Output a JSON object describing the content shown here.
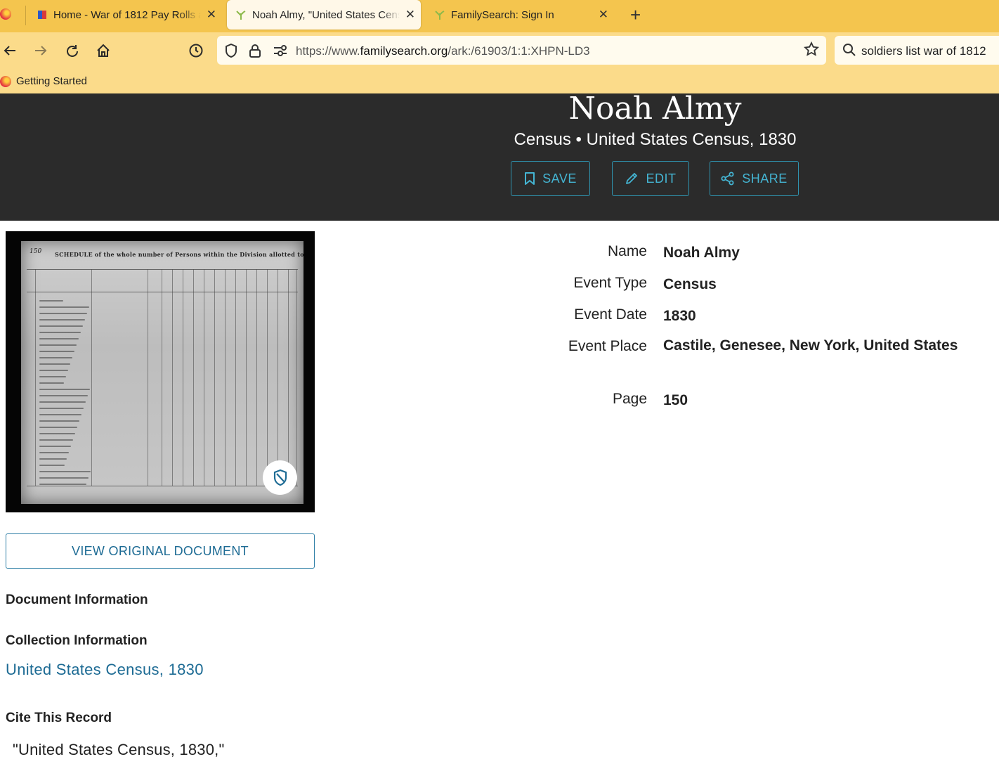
{
  "browser": {
    "tabs": [
      {
        "title": "Home - War of 1812 Pay Rolls and Muster Rolls"
      },
      {
        "title": "Noah Almy, \"United States Census, 1830\""
      },
      {
        "title": "FamilySearch: Sign In"
      }
    ],
    "url_prefix": "https://www.",
    "url_domain": "familysearch.org",
    "url_path": "/ark:/61903/1:1:XHPN-LD3",
    "search_query": "soldiers list war of 1812",
    "bookmark": "Getting Started"
  },
  "record": {
    "name": "Noah Almy",
    "subtitle": "Census • United States Census, 1830",
    "buttons": {
      "save": "SAVE",
      "edit": "EDIT",
      "share": "SHARE"
    },
    "facts": [
      {
        "label": "Name",
        "value": "Noah Almy"
      },
      {
        "label": "Event Type",
        "value": "Census"
      },
      {
        "label": "Event Date",
        "value": "1830"
      },
      {
        "label": "Event Place",
        "value": "Castile, Genesee, New York, United States"
      },
      {
        "label": "Page",
        "value": "150"
      }
    ]
  },
  "document_image": {
    "page_number": "150",
    "heading": "SCHEDULE of the whole number of Persons within the Division allotted to"
  },
  "left": {
    "view_button": "VIEW ORIGINAL DOCUMENT",
    "document_info": "Document Information",
    "collection_info": "Collection Information",
    "collection_link": "United States Census, 1830",
    "cite_heading": "Cite This Record",
    "cite_text": "\"United States Census, 1830,\""
  },
  "colors": {
    "tab_bar": "#f4c54e",
    "nav_bar": "#fbdb8a",
    "hero_bg": "#2b2b2b",
    "accent": "#44b4d2",
    "link": "#1d6b94"
  }
}
